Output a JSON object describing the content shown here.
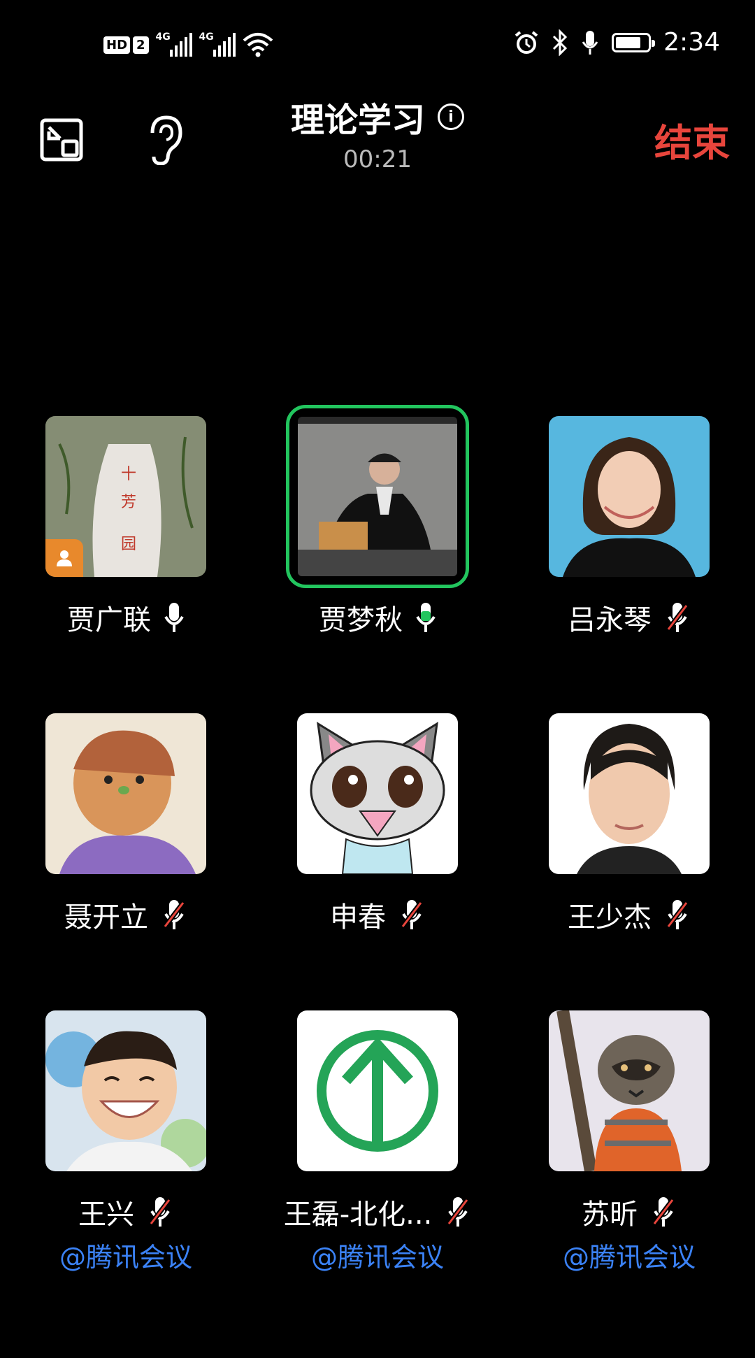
{
  "status_bar": {
    "time": "2:34",
    "hd_label": "HD",
    "hd_num": "2",
    "net1": "4G",
    "net2": "4G",
    "icons": [
      "hd-icon",
      "signal-icon",
      "signal-icon",
      "wifi-icon",
      "alarm-icon",
      "bluetooth-icon",
      "mic-icon",
      "battery-icon"
    ]
  },
  "header": {
    "title": "理论学习",
    "elapsed": "00:21",
    "end_label": "结束",
    "left_icons": [
      "shrink-window-icon",
      "ear-icon"
    ],
    "info_icon": "i"
  },
  "colors": {
    "end": "#e8453c",
    "speaking": "#22c55e",
    "tag": "#3b82f6",
    "muted_slash": "#e8453c",
    "host_badge": "#e8892c"
  },
  "participants": [
    {
      "name": "贾广联",
      "mic": "on",
      "host": true
    },
    {
      "name": "贾梦秋",
      "mic": "speaking",
      "active": true
    },
    {
      "name": "吕永琴",
      "mic": "muted"
    },
    {
      "name": "聂开立",
      "mic": "muted"
    },
    {
      "name": "申春",
      "mic": "muted"
    },
    {
      "name": "王少杰",
      "mic": "muted"
    },
    {
      "name": "王兴",
      "mic": "muted",
      "tag": "@腾讯会议"
    },
    {
      "name": "王磊-北化...",
      "mic": "muted",
      "tag": "@腾讯会议"
    },
    {
      "name": "苏昕",
      "mic": "muted",
      "tag": "@腾讯会议"
    }
  ]
}
